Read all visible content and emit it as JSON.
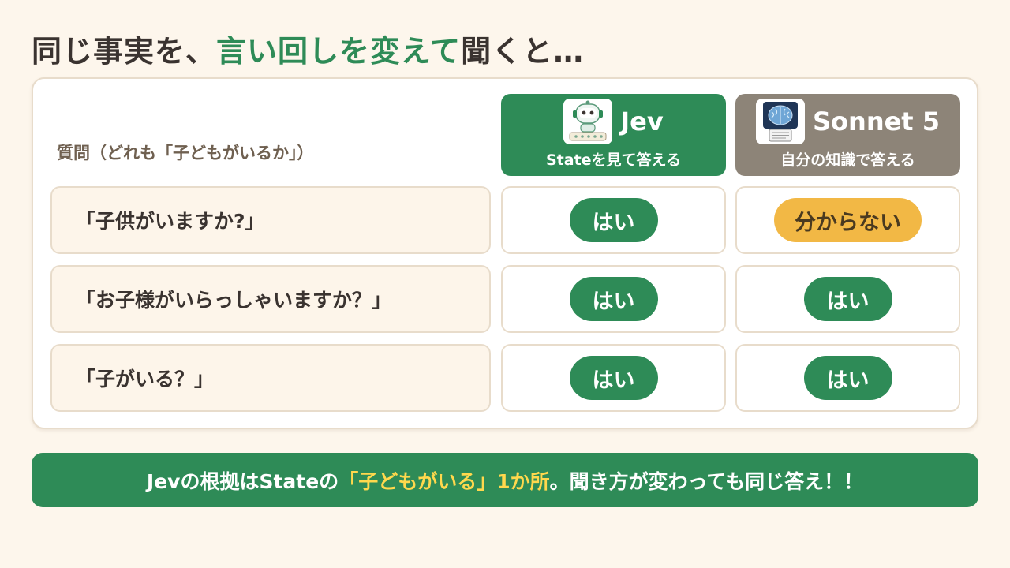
{
  "title": {
    "prefix": "同じ事実を、",
    "highlight": "言い回しを変えて",
    "suffix": "聞くと…"
  },
  "table": {
    "question_header": "質問（どれも「子どもがいるか」）",
    "columns": [
      {
        "name": "Jev",
        "subtitle": "Stateを見て答える",
        "icon": "robot-avatar-icon",
        "color": "#2e8b57"
      },
      {
        "name": "Sonnet 5",
        "subtitle": "自分の知識で答える",
        "icon": "brain-avatar-icon",
        "color": "#8d8478"
      }
    ],
    "rows": [
      {
        "question": "「子供がいますか?」",
        "jev": "はい",
        "sonnet": "分からない"
      },
      {
        "question": "「お子様がいらっしゃいますか？」",
        "jev": "はい",
        "sonnet": "はい"
      },
      {
        "question": "「子がいる？」",
        "jev": "はい",
        "sonnet": "はい"
      }
    ]
  },
  "banner": {
    "prefix": "Jevの根拠はStateの",
    "highlight": "「子どもがいる」1か所",
    "suffix": "。聞き方が変わっても同じ答え！！"
  },
  "colors": {
    "accent_green": "#2e8b57",
    "gray": "#8d8478",
    "unknown_yellow": "#f2b845",
    "banner_highlight": "#ffd84d",
    "background": "#fdf6ec"
  }
}
